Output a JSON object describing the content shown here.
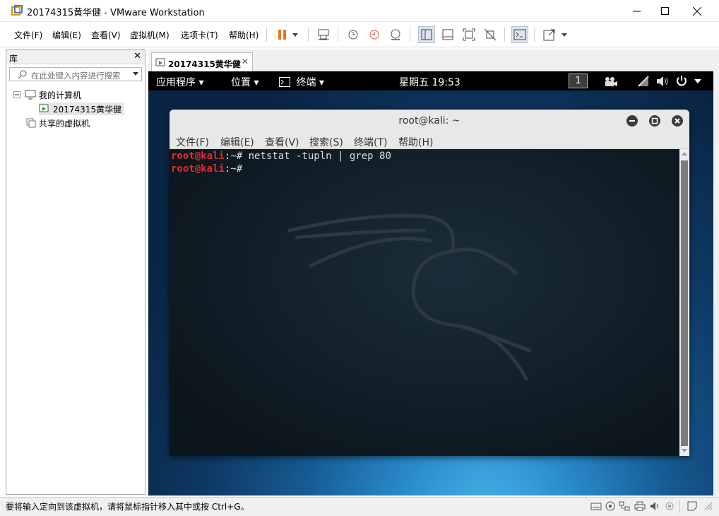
{
  "window": {
    "title": "20174315黄华健 - VMware Workstation"
  },
  "menu": [
    "文件(F)",
    "编辑(E)",
    "查看(V)",
    "虚拟机(M)",
    "选项卡(T)",
    "帮助(H)"
  ],
  "library": {
    "header": "库",
    "search_placeholder": "在此处键入内容进行搜索",
    "tree": {
      "my_computer": "我的计算机",
      "vm": "20174315黄华健",
      "shared": "共享的虚拟机"
    }
  },
  "tab": {
    "label": "20174315黄华健"
  },
  "gnome": {
    "apps": "应用程序",
    "places": "位置",
    "terminal": "终端",
    "clock": "星期五 19:53",
    "workspace": "1"
  },
  "terminal": {
    "title": "root@kali: ~",
    "menu": [
      "文件(F)",
      "编辑(E)",
      "查看(V)",
      "搜索(S)",
      "终端(T)",
      "帮助(H)"
    ],
    "lines": [
      {
        "user": "root@kali",
        "path": ":~",
        "prompt": "# ",
        "command": "netstat -tupln | grep 80"
      },
      {
        "user": "root@kali",
        "path": ":~",
        "prompt": "# ",
        "command": ""
      }
    ]
  },
  "status": {
    "message": "要将输入定向到该虚拟机，请将鼠标指针移入其中或按 Ctrl+G。"
  },
  "colors": {
    "prompt_user": "#e02b2b",
    "accent_pause": "#e8761c"
  }
}
